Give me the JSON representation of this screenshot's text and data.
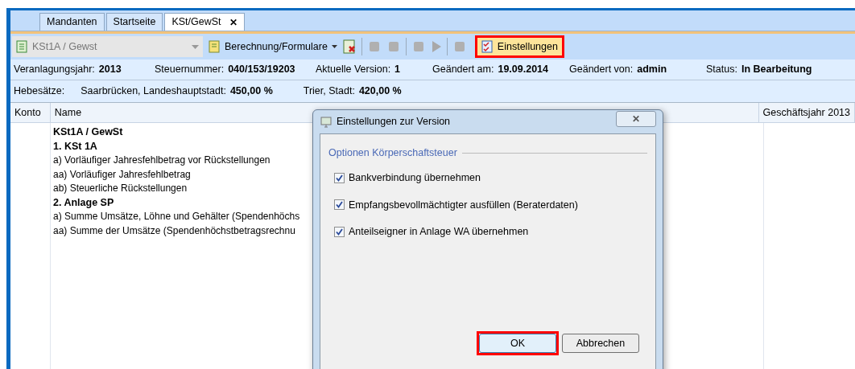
{
  "tabs": [
    {
      "label": "Mandanten",
      "selected": false
    },
    {
      "label": "Startseite",
      "selected": false
    },
    {
      "label": "KSt/GewSt",
      "selected": true,
      "close": "✕"
    }
  ],
  "toolbar": {
    "combo": {
      "value": "KSt1A / Gewst"
    },
    "menu": {
      "label": "Berechnung/Formulare"
    },
    "settings": {
      "label": "Einstellungen",
      "highlighted": true
    }
  },
  "info": [
    {
      "label": "Veranlagungsjahr:",
      "value": "2013"
    },
    {
      "label": "Steuernummer:",
      "value": "040/153/19203"
    },
    {
      "label": "Aktuelle Version:",
      "value": "1"
    },
    {
      "label": "Geändert am:",
      "value": "19.09.2014"
    },
    {
      "label": "Geändert von:",
      "value": "admin"
    },
    {
      "label": "Status:",
      "value": "In Bearbeitung"
    }
  ],
  "hebesaetze": {
    "label": "Hebesätze:",
    "items": [
      {
        "label": "Saarbrücken, Landeshauptstadt:",
        "value": "450,00 %"
      },
      {
        "label": "Trier, Stadt:",
        "value": "420,00 %"
      }
    ]
  },
  "table": {
    "columns": [
      "Konto",
      "Name",
      "Geschäftsjahr 2013"
    ],
    "rows": [
      {
        "kind": "heading",
        "name": "KSt1A / GewSt"
      },
      {
        "kind": "heading",
        "name": "1. KSt 1A"
      },
      {
        "kind": "item",
        "name": "a) Vorläufiger Jahresfehlbetrag vor Rückstellungen"
      },
      {
        "kind": "item",
        "name": "aa) Vorläufiger Jahresfehlbetrag"
      },
      {
        "kind": "item",
        "name": "ab) Steuerliche Rückstellungen"
      },
      {
        "kind": "heading",
        "name": "2. Anlage SP"
      },
      {
        "kind": "item",
        "name": "a) Summe Umsätze, Löhne und Gehälter (Spendenhöchs"
      },
      {
        "kind": "item",
        "name": "aa) Summe der Umsätze (Spendenhöchstbetragsrechnu"
      }
    ]
  },
  "dialog": {
    "title": "Einstellungen zur Version",
    "close": "✕",
    "group": "Optionen Körperschaftsteuer",
    "options": [
      {
        "label": "Bankverbindung übernehmen",
        "checked": true
      },
      {
        "label": "Empfangsbevollmächtigter ausfüllen (Beraterdaten)",
        "checked": true
      },
      {
        "label": "Anteilseigner in Anlage WA übernehmen",
        "checked": true
      }
    ],
    "buttons": [
      {
        "label": "OK",
        "highlighted": true
      },
      {
        "label": "Abbrechen",
        "highlighted": false
      }
    ]
  }
}
